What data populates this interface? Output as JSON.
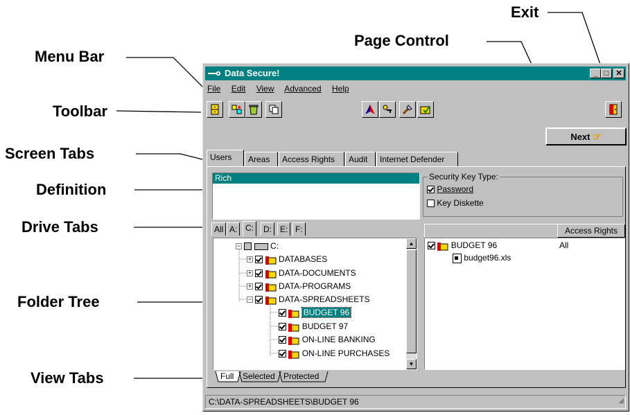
{
  "callouts": {
    "menu_bar": "Menu Bar",
    "toolbar": "Toolbar",
    "screen_tabs": "Screen Tabs",
    "definition": "Definition",
    "drive_tabs": "Drive Tabs",
    "folder_tree": "Folder Tree",
    "view_tabs": "View Tabs",
    "exit": "Exit",
    "page_control": "Page Control"
  },
  "window": {
    "title": "Data Secure!",
    "title_bar_color": "#008080",
    "menu": [
      "File",
      "Edit",
      "View",
      "Advanced",
      "Help"
    ],
    "next_button": "Next",
    "screen_tabs": [
      "Users",
      "Areas",
      "Access Rights",
      "Audit",
      "Internet Defender"
    ],
    "active_screen_tab": "Users",
    "definition": {
      "selected_user": "Rich"
    },
    "security_key": {
      "legend": "Security Key Type:",
      "options": [
        {
          "label": "Password",
          "checked": true
        },
        {
          "label": "Key Diskette",
          "checked": false
        }
      ]
    },
    "drive_tabs": [
      "All",
      "A:",
      "C:",
      "D:",
      "E:",
      "F:"
    ],
    "active_drive_tab": "C:",
    "tree": {
      "root": "C:",
      "items": [
        "DATABASES",
        "DATA-DOCUMENTS",
        "DATA-PROGRAMS",
        "DATA-SPREADSHEETS",
        "BUDGET 96",
        "BUDGET 97",
        "ON-LINE BANKING",
        "ON-LINE PURCHASES"
      ],
      "selected": "BUDGET 96"
    },
    "rights_header": "Access Rights",
    "rights_list": {
      "folder": "BUDGET 96",
      "folder_rights": "All",
      "file": "budget96.xls"
    },
    "view_tabs": [
      "Full",
      "Selected",
      "Protected"
    ],
    "status_path": "C:\\DATA-SPREADSHEETS\\BUDGET 96"
  }
}
